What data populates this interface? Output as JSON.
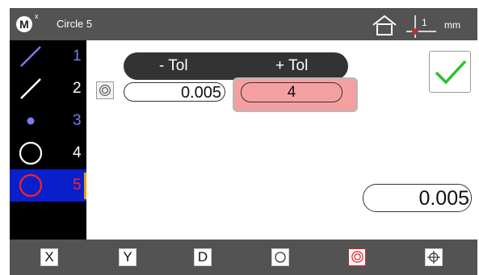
{
  "header": {
    "title": "Circle 5",
    "logo_letter": "M",
    "logo_badge": "x",
    "axis_label": "1",
    "unit": "mm"
  },
  "features": [
    {
      "number": "1",
      "icon": "line-feature-icon",
      "color": "#7b7bf0"
    },
    {
      "number": "2",
      "icon": "line-feature-icon",
      "color": "#ffffff"
    },
    {
      "number": "3",
      "icon": "point-feature-icon",
      "color": "#7b7bf0"
    },
    {
      "number": "4",
      "icon": "circle-feature-icon",
      "color": "#ffffff"
    },
    {
      "number": "5",
      "icon": "circle-feature-icon",
      "color": "#ff2020",
      "selected": true
    }
  ],
  "tolerance": {
    "minus_label": "- Tol",
    "plus_label": "+ Tol",
    "lower_value": "0.005",
    "upper_value": "4"
  },
  "result_value": "0.005",
  "toolbar": {
    "x_label": "X",
    "y_label": "Y",
    "d_label": "D"
  },
  "colors": {
    "bar": "#535353",
    "selected_row": "#0a1fcc",
    "selected_marker": "#f0a000",
    "active_field": "#f5a0a0",
    "check": "#28c328",
    "active_tool": "#e02020"
  }
}
